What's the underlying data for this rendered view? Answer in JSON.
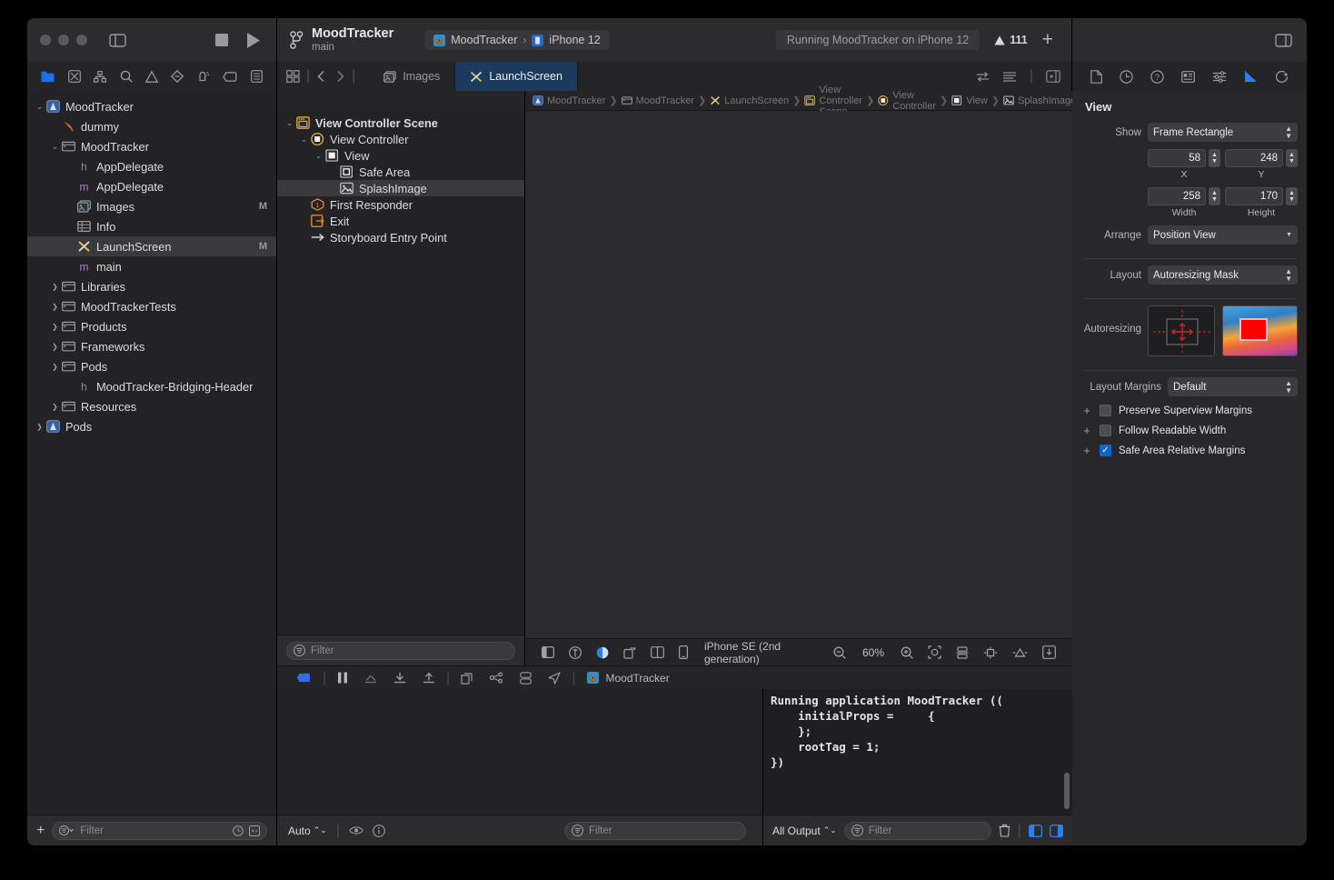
{
  "titlebar": {
    "scheme_name": "MoodTracker",
    "branch": "main",
    "dest_scheme": "MoodTracker",
    "dest_device": "iPhone 12",
    "status_text": "Running MoodTracker on iPhone 12",
    "warning_count": "111",
    "plus_label": "+",
    "chevron": "›"
  },
  "tabs": [
    {
      "label": "Images",
      "icon": "images-icon",
      "selected": false
    },
    {
      "label": "LaunchScreen",
      "icon": "storyboard-icon",
      "selected": true
    }
  ],
  "navigator": {
    "items": [
      {
        "label": "MoodTracker",
        "indent": 0,
        "disclosure": "open",
        "icon": "project-icon",
        "badge": "",
        "selected": false
      },
      {
        "label": "dummy",
        "indent": 1,
        "disclosure": "",
        "icon": "swift-icon",
        "badge": "",
        "selected": false
      },
      {
        "label": "MoodTracker",
        "indent": 1,
        "disclosure": "open",
        "icon": "folder-icon",
        "badge": "",
        "selected": false
      },
      {
        "label": "AppDelegate",
        "indent": 2,
        "disclosure": "",
        "icon": "header-icon",
        "badge": "",
        "selected": false
      },
      {
        "label": "AppDelegate",
        "indent": 2,
        "disclosure": "",
        "icon": "objc-icon",
        "badge": "",
        "selected": false
      },
      {
        "label": "Images",
        "indent": 2,
        "disclosure": "",
        "icon": "assets-icon",
        "badge": "M",
        "selected": false
      },
      {
        "label": "Info",
        "indent": 2,
        "disclosure": "",
        "icon": "plist-icon",
        "badge": "",
        "selected": false
      },
      {
        "label": "LaunchScreen",
        "indent": 2,
        "disclosure": "",
        "icon": "storyboard-icon",
        "badge": "M",
        "selected": true
      },
      {
        "label": "main",
        "indent": 2,
        "disclosure": "",
        "icon": "objc-icon",
        "badge": "",
        "selected": false
      },
      {
        "label": "Libraries",
        "indent": 1,
        "disclosure": "closed",
        "icon": "folder-icon",
        "badge": "",
        "selected": false
      },
      {
        "label": "MoodTrackerTests",
        "indent": 1,
        "disclosure": "closed",
        "icon": "folder-icon",
        "badge": "",
        "selected": false
      },
      {
        "label": "Products",
        "indent": 1,
        "disclosure": "closed",
        "icon": "folder-icon",
        "badge": "",
        "selected": false
      },
      {
        "label": "Frameworks",
        "indent": 1,
        "disclosure": "closed",
        "icon": "folder-icon",
        "badge": "",
        "selected": false
      },
      {
        "label": "Pods",
        "indent": 1,
        "disclosure": "closed",
        "icon": "folder-icon",
        "badge": "",
        "selected": false
      },
      {
        "label": "MoodTracker-Bridging-Header",
        "indent": 2,
        "disclosure": "",
        "icon": "header-icon",
        "badge": "",
        "selected": false
      },
      {
        "label": "Resources",
        "indent": 1,
        "disclosure": "closed",
        "icon": "folder-icon",
        "badge": "",
        "selected": false
      },
      {
        "label": "Pods",
        "indent": 0,
        "disclosure": "closed",
        "icon": "project-icon",
        "badge": "",
        "selected": false
      }
    ],
    "filter_placeholder": "Filter",
    "add_label": "+"
  },
  "breadcrumbs": [
    {
      "label": "MoodTracker",
      "icon": "project-icon"
    },
    {
      "label": "MoodTracker",
      "icon": "folder-icon"
    },
    {
      "label": "LaunchScreen",
      "icon": "storyboard-icon"
    },
    {
      "label": "View Controller Scene",
      "icon": "scene-icon"
    },
    {
      "label": "View Controller",
      "icon": "viewcontroller-icon"
    },
    {
      "label": "View",
      "icon": "view-icon"
    },
    {
      "label": "SplashImage",
      "icon": "imageview-icon"
    }
  ],
  "doctree": {
    "items": [
      {
        "label": "View Controller Scene",
        "indent": 0,
        "disclosure": "open",
        "icon": "scene-icon",
        "selected": false
      },
      {
        "label": "View Controller",
        "indent": 1,
        "disclosure": "open",
        "icon": "viewcontroller-icon",
        "selected": false
      },
      {
        "label": "View",
        "indent": 2,
        "disclosure": "open",
        "icon": "view-icon",
        "selected": false
      },
      {
        "label": "Safe Area",
        "indent": 3,
        "disclosure": "",
        "icon": "safearea-icon",
        "selected": false
      },
      {
        "label": "SplashImage",
        "indent": 3,
        "disclosure": "",
        "icon": "imageview-icon",
        "selected": true
      },
      {
        "label": "First Responder",
        "indent": 1,
        "disclosure": "",
        "icon": "firstresponder-icon",
        "selected": false
      },
      {
        "label": "Exit",
        "indent": 1,
        "disclosure": "",
        "icon": "exit-icon",
        "selected": false
      },
      {
        "label": "Storyboard Entry Point",
        "indent": 1,
        "disclosure": "",
        "icon": "entrypoint-icon",
        "selected": false
      }
    ],
    "filter_placeholder": "Filter"
  },
  "canvas_bar": {
    "device_label": "iPhone SE (2nd generation)",
    "zoom_level": "60%"
  },
  "debug": {
    "process_name": "MoodTracker",
    "console_text": "Running application MoodTracker ((\n    initialProps =     {\n    };\n    rootTag = 1;\n})",
    "auto_label": "Auto",
    "all_output_label": "All Output",
    "filter_placeholder": "Filter",
    "variables_filter_placeholder": "Filter"
  },
  "inspector": {
    "title": "View",
    "show_label": "Show",
    "show_value": "Frame Rectangle",
    "x_label": "X",
    "x_value": "58",
    "y_label": "Y",
    "y_value": "248",
    "width_label": "Width",
    "width_value": "258",
    "height_label": "Height",
    "height_value": "170",
    "arrange_label": "Arrange",
    "arrange_value": "Position View",
    "layout_label": "Layout",
    "layout_value": "Autoresizing Mask",
    "autoresizing_label": "Autoresizing",
    "layout_margins_label": "Layout Margins",
    "layout_margins_value": "Default",
    "checkboxes": [
      {
        "label": "Preserve Superview Margins",
        "checked": false
      },
      {
        "label": "Follow Readable Width",
        "checked": false
      },
      {
        "label": "Safe Area Relative Margins",
        "checked": true
      }
    ]
  },
  "colors": {
    "accent": "#2f7ef0",
    "selected_tab_bg": "#1c3a5c",
    "splash_bg": "#1a7aad",
    "splash_card": "#2188c4",
    "warning_yellow": "#e0b341"
  }
}
